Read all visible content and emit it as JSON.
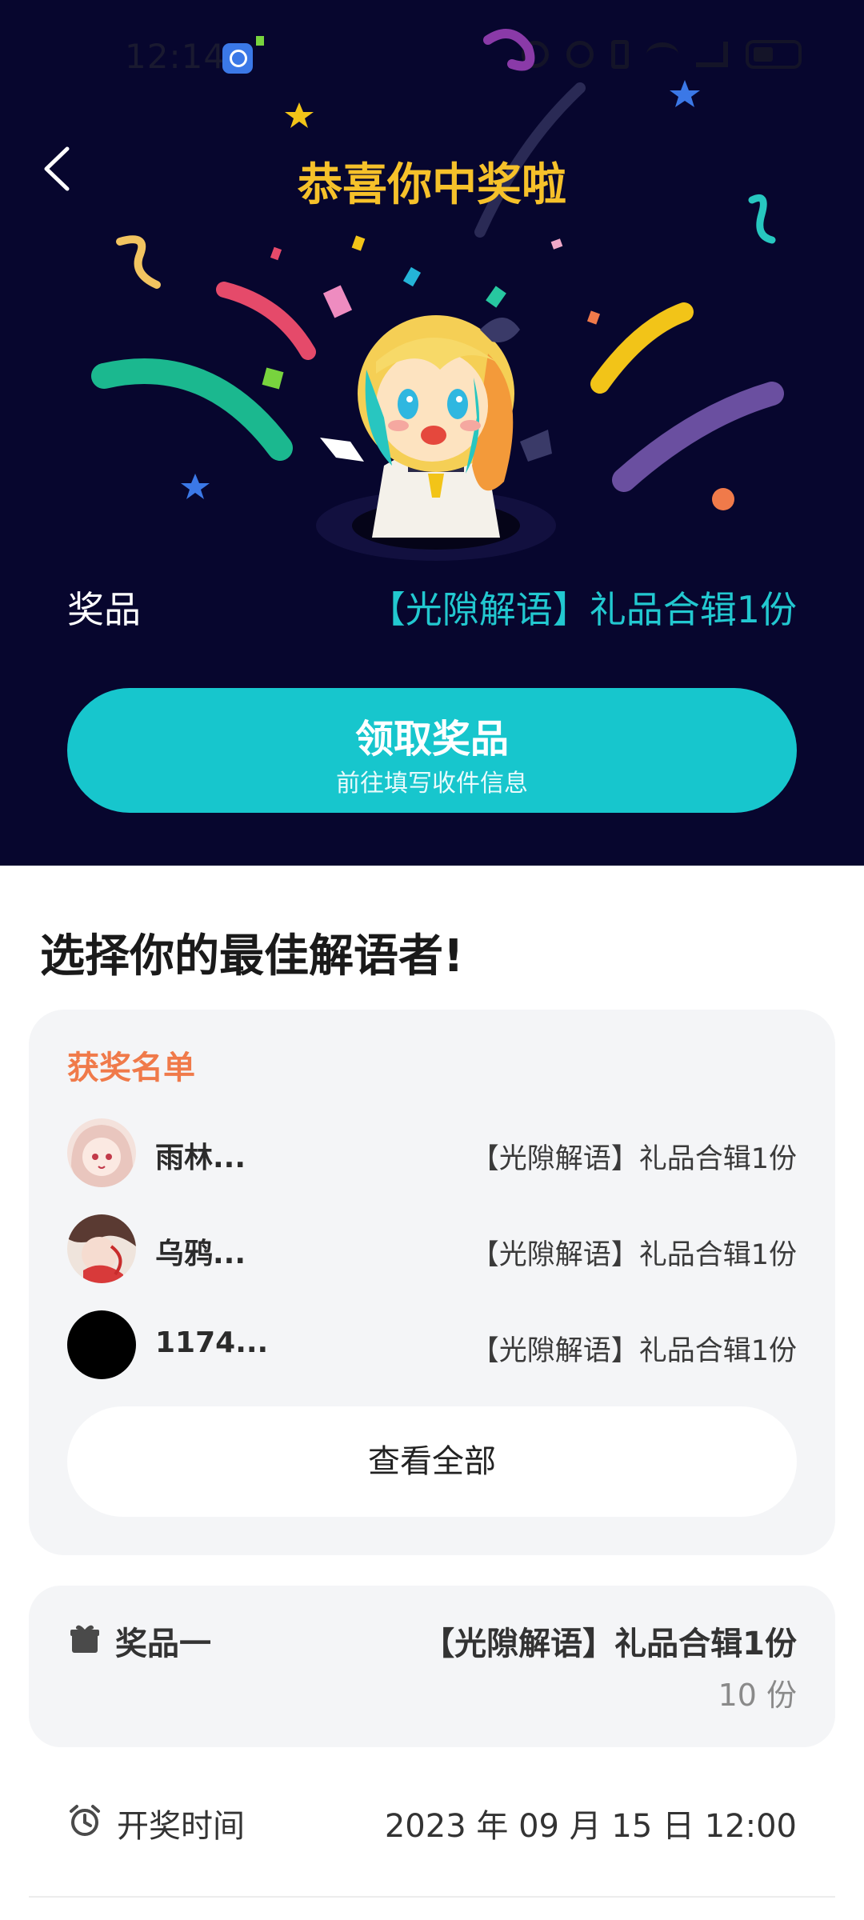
{
  "status_bar": {
    "time": "12:14"
  },
  "header": {
    "title": "恭喜你中奖啦"
  },
  "prize": {
    "label": "奖品",
    "value": "【光隙解语】礼品合辑1份"
  },
  "claim_button": {
    "label": "领取奖品",
    "sublabel": "前往填写收件信息"
  },
  "section_title": "选择你的最佳解语者!",
  "winners": {
    "heading": "获奖名单",
    "rows": [
      {
        "name": "雨林...",
        "prize": "【光隙解语】礼品合辑1份"
      },
      {
        "name": "乌鸦...",
        "prize": "【光隙解语】礼品合辑1份"
      },
      {
        "name": "1174...",
        "prize": "【光隙解语】礼品合辑1份"
      }
    ],
    "view_all_label": "查看全部"
  },
  "prize_one": {
    "label": "奖品一",
    "value": "【光隙解语】礼品合辑1份",
    "count": "10 份"
  },
  "draw_time": {
    "label": "开奖时间",
    "value": "2023 年 09 月 15 日 12:00"
  },
  "colors": {
    "hero_bg": "#07062e",
    "accent_teal": "#17c6cd",
    "title_gold": "#f6c12a",
    "winners_heading": "#f07a4a"
  }
}
